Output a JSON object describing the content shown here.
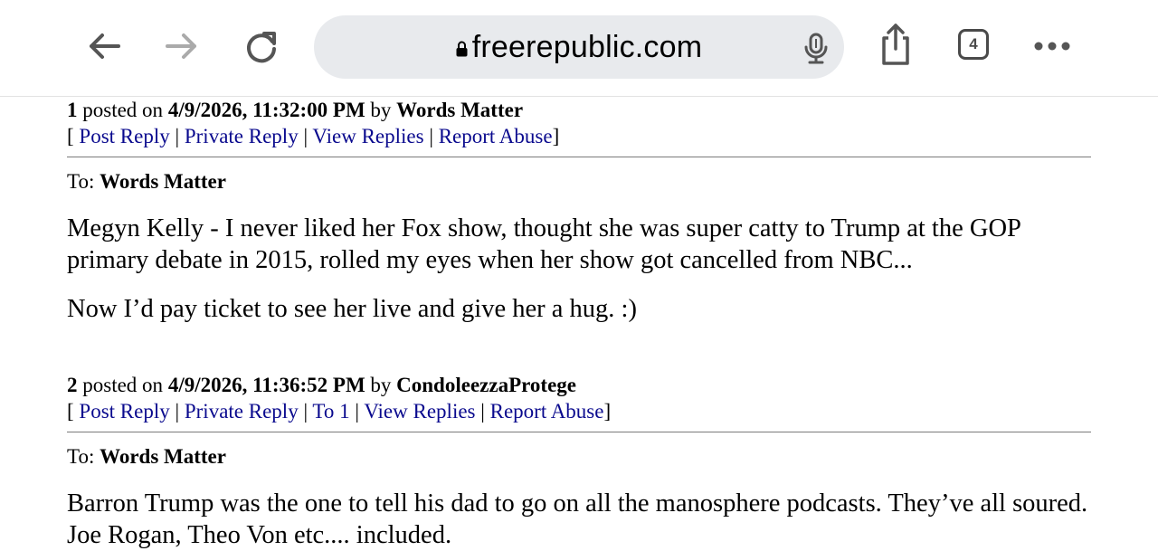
{
  "browser": {
    "url": "freerepublic.com",
    "tab_count": "4"
  },
  "posts": [
    {
      "number": "1",
      "posted_on_text": "posted on",
      "date": "4/9/2026, 11:32:00 PM",
      "by_text": "by",
      "author": "Words Matter",
      "actions": {
        "open": "[",
        "post_reply": "Post Reply",
        "private_reply": "Private Reply",
        "view_replies": "View Replies",
        "report_abuse": "Report Abuse",
        "close": "]"
      },
      "to_label": "To:",
      "to_name": "Words Matter",
      "paragraphs": [
        "Megyn Kelly - I never liked her Fox show, thought she was super catty to Trump at the GOP primary debate in 2015, rolled my eyes when her show got cancelled from NBC...",
        "Now I’d pay ticket to see her live and give her a hug. :)"
      ]
    },
    {
      "number": "2",
      "posted_on_text": "posted on",
      "date": "4/9/2026, 11:36:52 PM",
      "by_text": "by",
      "author": "CondoleezzaProtege",
      "actions": {
        "open": "[",
        "post_reply": "Post Reply",
        "private_reply": "Private Reply",
        "to_1": "To 1",
        "view_replies": "View Replies",
        "report_abuse": "Report Abuse",
        "close": "]"
      },
      "to_label": "To:",
      "to_name": "Words Matter",
      "paragraphs": [
        "Barron Trump was the one to tell his dad to go on all the manosphere podcasts. They’ve all soured.",
        "Joe Rogan, Theo Von etc.... included."
      ]
    }
  ]
}
